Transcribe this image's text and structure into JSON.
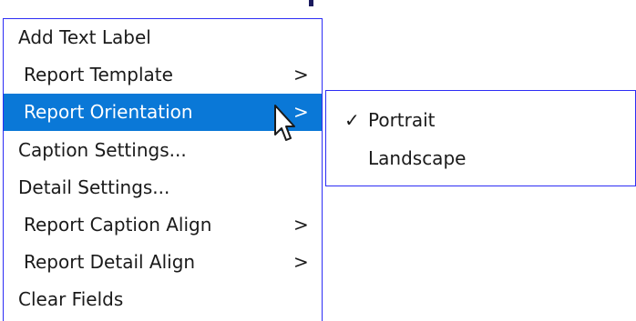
{
  "menu": {
    "items": [
      {
        "label": "Add Text Label",
        "arrow": ""
      },
      {
        "label": "Report Template",
        "arrow": ">"
      },
      {
        "label": "Report Orientation",
        "arrow": ">"
      },
      {
        "label": "Caption Settings...",
        "arrow": ""
      },
      {
        "label": "Detail Settings...",
        "arrow": ""
      },
      {
        "label": "Report Caption Align",
        "arrow": ">"
      },
      {
        "label": "Report Detail Align",
        "arrow": ">"
      },
      {
        "label": "Clear Fields",
        "arrow": ""
      }
    ],
    "highlighted_index": 2
  },
  "submenu": {
    "items": [
      {
        "label": "Portrait",
        "check": "✓",
        "checked": true
      },
      {
        "label": "Landscape",
        "check": "",
        "checked": false
      }
    ]
  },
  "colors": {
    "highlight": "#0a78d7",
    "border": "#2d2df5",
    "text": "#1a1a1a"
  },
  "icons": {
    "cursor": "mouse-pointer-icon"
  }
}
